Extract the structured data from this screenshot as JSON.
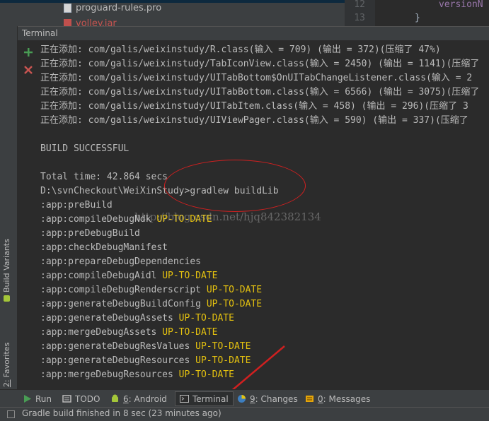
{
  "project_tree": {
    "items": [
      {
        "label": "proguard-rules.pro"
      },
      {
        "label": "volley.jar"
      }
    ]
  },
  "editor": {
    "line_numbers": [
      "12",
      "13"
    ],
    "lines": [
      "versionN",
      "}"
    ]
  },
  "terminal": {
    "title": "Terminal",
    "lines": [
      {
        "text": "正在添加: com/galis/weixinstudy/R.class(输入 = 709) (输出 = 372)(压缩了 47%)"
      },
      {
        "text": "正在添加: com/galis/weixinstudy/TabIconView.class(输入 = 2450) (输出 = 1141)(压缩了"
      },
      {
        "text": "正在添加: com/galis/weixinstudy/UITabBottom$OnUITabChangeListener.class(输入 = 2"
      },
      {
        "text": "正在添加: com/galis/weixinstudy/UITabBottom.class(输入 = 6566) (输出 = 3075)(压缩了"
      },
      {
        "text": "正在添加: com/galis/weixinstudy/UITabItem.class(输入 = 458) (输出 = 296)(压缩了 3"
      },
      {
        "text": "正在添加: com/galis/weixinstudy/UIViewPager.class(输入 = 590) (输出 = 337)(压缩了"
      },
      {
        "text": ""
      },
      {
        "text": "BUILD SUCCESSFUL"
      },
      {
        "text": ""
      },
      {
        "text": "Total time: 42.864 secs"
      },
      {
        "text": "D:\\svnCheckout\\WeiXinStudy>gradlew buildLib"
      },
      {
        "text": ":app:preBuild"
      },
      {
        "text": ":app:compileDebugNdk ",
        "status": "UP-TO-DATE"
      },
      {
        "text": ":app:preDebugBuild"
      },
      {
        "text": ":app:checkDebugManifest"
      },
      {
        "text": ":app:prepareDebugDependencies"
      },
      {
        "text": ":app:compileDebugAidl ",
        "status": "UP-TO-DATE"
      },
      {
        "text": ":app:compileDebugRenderscript ",
        "status": "UP-TO-DATE"
      },
      {
        "text": ":app:generateDebugBuildConfig ",
        "status": "UP-TO-DATE"
      },
      {
        "text": ":app:generateDebugAssets ",
        "status": "UP-TO-DATE"
      },
      {
        "text": ":app:mergeDebugAssets ",
        "status": "UP-TO-DATE"
      },
      {
        "text": ":app:generateDebugResValues ",
        "status": "UP-TO-DATE"
      },
      {
        "text": ":app:generateDebugResources ",
        "status": "UP-TO-DATE"
      },
      {
        "text": ":app:mergeDebugResources ",
        "status": "UP-TO-DATE"
      }
    ]
  },
  "left_stripe": {
    "build_variants_prefix": "",
    "build_variants_label": "Build Variants",
    "favorites_prefix": "2:",
    "favorites_label": "Favorites"
  },
  "watermark": "http://blog.csdn.net/hjq842382134",
  "toolbar": {
    "run": "Run",
    "todo": "TODO",
    "android_num": "6",
    "android_label": ": Android",
    "terminal": "Terminal",
    "changes_num": "9",
    "changes_label": ": Changes",
    "messages_num": "0",
    "messages_label": ": Messages"
  },
  "status_bar": {
    "text": "Gradle build finished in 8 sec (23 minutes ago)"
  },
  "colors": {
    "accent_green": "#499c54",
    "accent_red": "#c75450",
    "uptodate_yellow": "#e5c20f",
    "annotation_red": "#d02020"
  }
}
